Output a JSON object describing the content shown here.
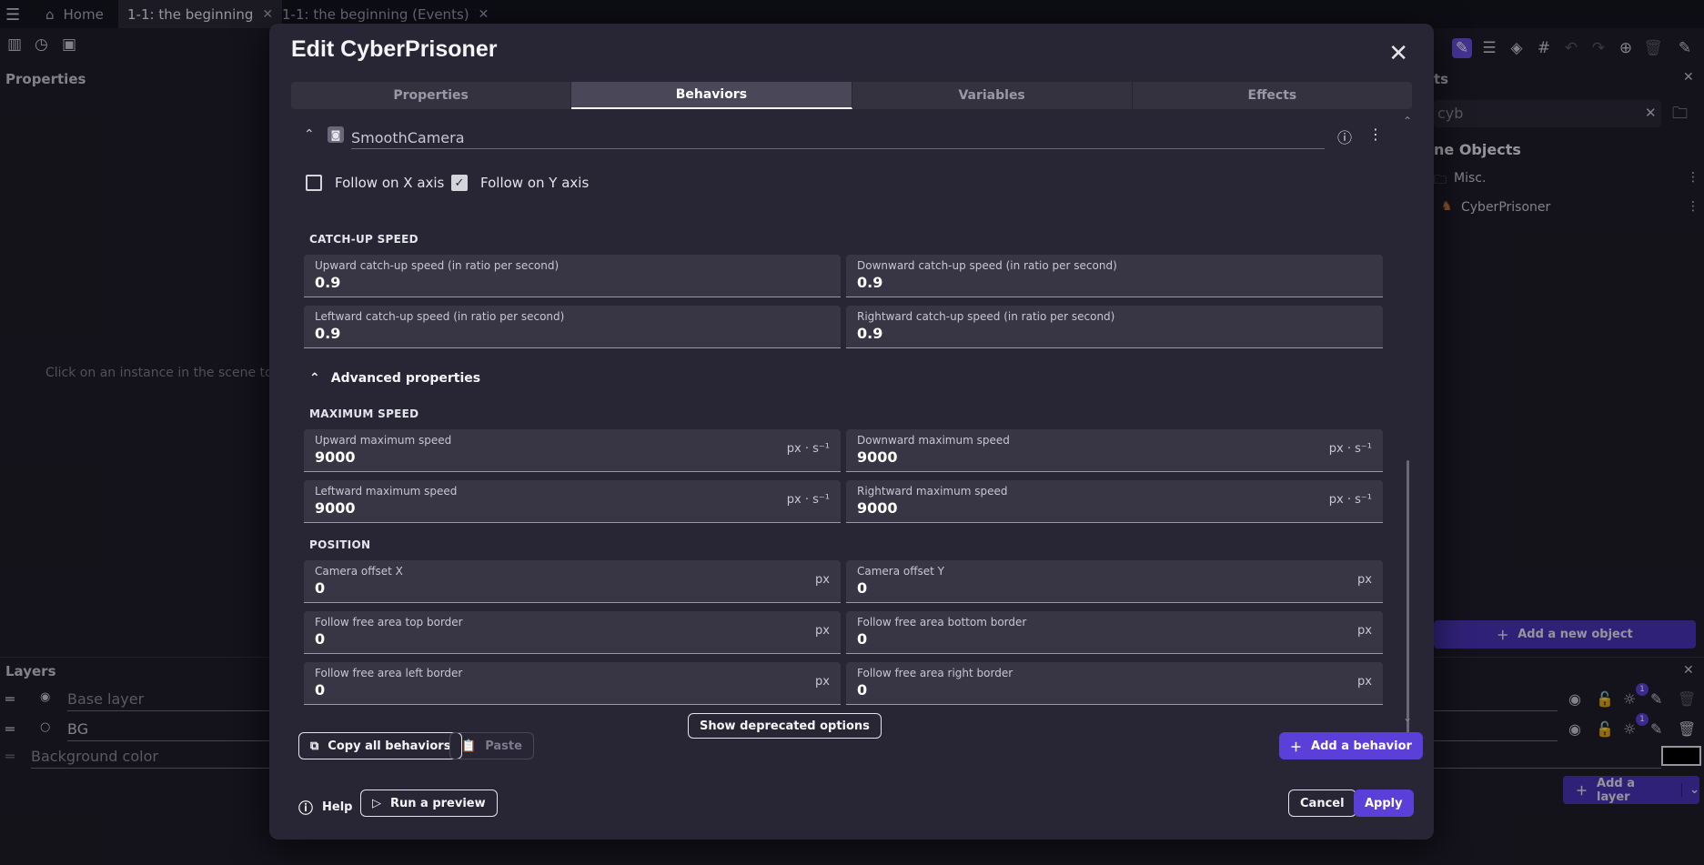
{
  "app": {
    "tabs": [
      {
        "label": "Home"
      },
      {
        "label": "1-1: the beginning"
      },
      {
        "label": "1-1: the beginning (Events)"
      }
    ],
    "properties_title": "Properties",
    "properties_hint": "Click on an instance in the scene to dis",
    "layers_title": "Layers",
    "layers": [
      {
        "label": "Base layer"
      },
      {
        "label": "BG"
      }
    ],
    "background_color_label": "Background color",
    "objects_title": "ts",
    "search_value": "cyb",
    "scene_objects_title": "ne Objects",
    "folder_label": "Misc.",
    "object_label": "CyberPrisoner",
    "add_object_label": "Add a new object",
    "add_layer_label": "Add a layer",
    "badge_count": "1"
  },
  "dialog": {
    "title": "Edit CyberPrisoner",
    "tabs": [
      "Properties",
      "Behaviors",
      "Variables",
      "Effects"
    ],
    "behavior_name": "SmoothCamera",
    "follow_x_label": "Follow on X axis",
    "follow_y_label": "Follow on Y axis",
    "follow_x_checked": false,
    "follow_y_checked": true,
    "catchup_title": "CATCH-UP SPEED",
    "catchup": [
      {
        "label": "Upward catch-up speed (in ratio per second)",
        "value": "0.9",
        "unit": ""
      },
      {
        "label": "Downward catch-up speed (in ratio per second)",
        "value": "0.9",
        "unit": ""
      },
      {
        "label": "Leftward catch-up speed (in ratio per second)",
        "value": "0.9",
        "unit": ""
      },
      {
        "label": "Rightward catch-up speed (in ratio per second)",
        "value": "0.9",
        "unit": ""
      }
    ],
    "advanced_label": "Advanced properties",
    "maxspeed_title": "MAXIMUM SPEED",
    "maxspeed": [
      {
        "label": "Upward maximum speed",
        "value": "9000",
        "unit": "px · s⁻¹"
      },
      {
        "label": "Downward maximum speed",
        "value": "9000",
        "unit": "px · s⁻¹"
      },
      {
        "label": "Leftward maximum speed",
        "value": "9000",
        "unit": "px · s⁻¹"
      },
      {
        "label": "Rightward maximum speed",
        "value": "9000",
        "unit": "px · s⁻¹"
      }
    ],
    "position_title": "POSITION",
    "position": [
      {
        "label": "Camera offset X",
        "value": "0",
        "unit": "px"
      },
      {
        "label": "Camera offset Y",
        "value": "0",
        "unit": "px"
      },
      {
        "label": "Follow free area top border",
        "value": "0",
        "unit": "px"
      },
      {
        "label": "Follow free area bottom border",
        "value": "0",
        "unit": "px"
      },
      {
        "label": "Follow free area left border",
        "value": "0",
        "unit": "px"
      },
      {
        "label": "Follow free area right border",
        "value": "0",
        "unit": "px"
      }
    ],
    "deprecated_label": "Show deprecated options",
    "copy_all_label": "Copy all behaviors",
    "paste_label": "Paste",
    "add_behavior_label": "Add a behavior",
    "help_label": "Help",
    "run_preview_label": "Run a preview",
    "cancel_label": "Cancel",
    "apply_label": "Apply"
  },
  "colors": {
    "accent": "#5b3fd9",
    "dialog_bg": "#282634",
    "app_bg": "#1f1d28"
  }
}
